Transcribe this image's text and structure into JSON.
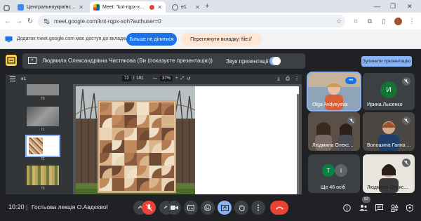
{
  "browser": {
    "tabs": [
      {
        "title": "Центральноукраїнський держ",
        "favicon_color": "#4285f4",
        "active": false
      },
      {
        "title": "Meet: \"knt-rqpx-xoh\"",
        "favicon_color": "#00897b",
        "active": true
      },
      {
        "title": "e1",
        "favicon_color": "#5f6368",
        "active": false
      }
    ],
    "new_tab_label": "+",
    "url": "meet.google.com/knt-rqpx-xoh?authuser=0"
  },
  "sharing_bar": {
    "message": "Додаток meet.google.com має доступ до вкладки file://",
    "stop_sharing_label": "Більше не ділитися",
    "switch_tab_label": "Переглянути вкладку: file://"
  },
  "meet": {
    "presenter_text": "Людмила Олександрівна Чистякова (Ви (показуєте презентацію))",
    "audio_label": "Звук презентації",
    "audio_enabled": true,
    "stop_presenting_label": "Зупинити презентацію",
    "pdf": {
      "file_name": "e1",
      "current_page": "72",
      "total_pages": "101",
      "zoom": "37%",
      "thumbnails": [
        {
          "label": "70"
        },
        {
          "label": "71"
        },
        {
          "label": "72",
          "selected": true
        },
        {
          "label": "73"
        }
      ]
    },
    "participants": [
      {
        "name": "Olga Avdyeyeva",
        "active_speaker": true
      },
      {
        "name": "Ирина Лысенко",
        "initial": "И",
        "avatar_color": "#137333",
        "muted": true
      },
      {
        "name": "Людмила Олекс...",
        "muted": true
      },
      {
        "name": "Волошина Ганна ...",
        "muted": true
      },
      {
        "name": "Ще 46 осіб",
        "initials": [
          "Т",
          "І"
        ]
      },
      {
        "name": "Людмила Олекс...",
        "muted": true
      }
    ],
    "time": "10:20",
    "separator": "|",
    "meeting_title": "Гостьова лекція О.Авдєєвої",
    "people_count": "52"
  }
}
